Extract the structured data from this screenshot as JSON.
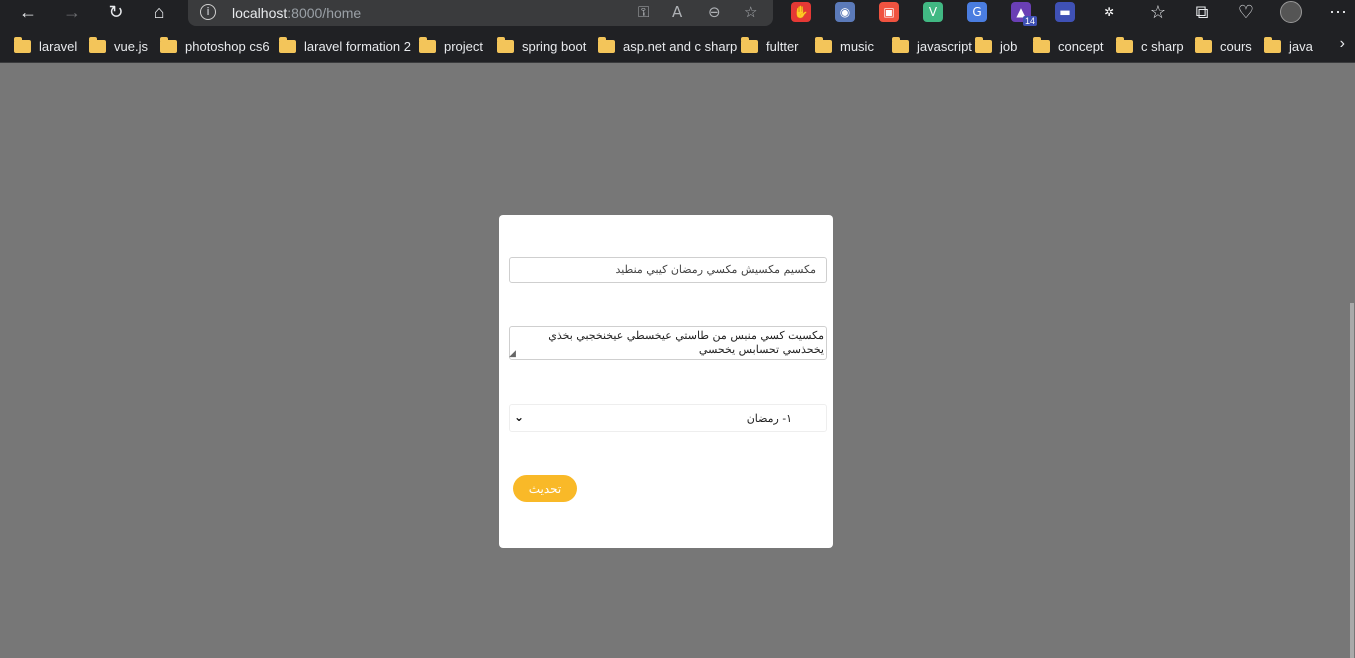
{
  "browser": {
    "url_host": "localhost",
    "url_path": ":8000/home",
    "icons": [
      "back-icon",
      "forward-icon",
      "refresh-icon",
      "home-icon",
      "site-info-icon",
      "key-icon",
      "read-aloud-icon",
      "zoom-out-icon",
      "add-favorite-icon",
      "favorites-icon",
      "collections-icon",
      "browser-essentials-icon",
      "profile-icon",
      "more-icon"
    ],
    "extensions": [
      {
        "name": "adblock-extension",
        "color": "#e53935",
        "glyph": "✋"
      },
      {
        "name": "circle-extension",
        "color": "#5b7ab9",
        "glyph": "◉"
      },
      {
        "name": "laravel-extension",
        "color": "#f05340",
        "glyph": "▣"
      },
      {
        "name": "vue-extension",
        "color": "#41b883",
        "glyph": "V"
      },
      {
        "name": "translate-extension",
        "color": "#4a7de0",
        "glyph": "G"
      },
      {
        "name": "mortarboard-extension",
        "color": "#6a3fb5",
        "glyph": "▲",
        "badge": "14"
      },
      {
        "name": "chat-extension",
        "color": "#3f51b5",
        "glyph": "▬"
      },
      {
        "name": "puzzle-extension",
        "color": "#202124",
        "glyph": "✲"
      }
    ]
  },
  "bookmarks": [
    "laravel",
    "vue.js",
    "photoshop cs6",
    "laravel formation 2",
    "project",
    "spring boot",
    "asp.net and c sharp",
    "fultter",
    "music",
    "javascript",
    "job",
    "concept",
    "c sharp",
    "cours",
    "java"
  ],
  "form": {
    "input_value": "مكسيم مكسيش مكسي رمضان كيبي منطيد",
    "textarea_value": "مكسيت كسي منبس من طاستي عيخسطي عيخنخجبي بخذي يخحذسي تحسابس يخحسي",
    "select_value": "١- رمضان",
    "submit_label": "تحديث"
  }
}
